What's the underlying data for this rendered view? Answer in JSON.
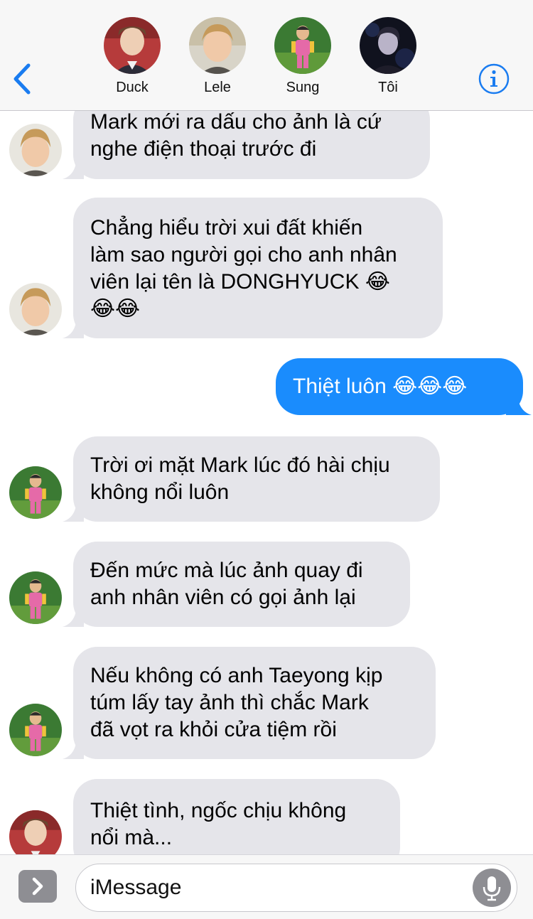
{
  "header": {
    "back_icon": "chevron-left-icon",
    "info_icon": "info-icon",
    "accent_color": "#1a7cf0",
    "participants": [
      {
        "name": "Duck"
      },
      {
        "name": "Lele"
      },
      {
        "name": "Sung"
      },
      {
        "name": "Tôi"
      }
    ]
  },
  "messages": [
    {
      "sender": "Lele",
      "direction": "incoming",
      "lines": [
        "Mark mới ra dấu cho ảnh là cứ",
        "nghe điện thoại trước đi"
      ]
    },
    {
      "sender": "Lele",
      "direction": "incoming",
      "lines": [
        "Chẳng hiểu trời xui đất khiến",
        "làm sao người gọi cho anh nhân",
        "viên lại tên là DONGHYUCK",
        ""
      ],
      "emoji_line3": "😂",
      "emoji_line4": "😂😂"
    },
    {
      "sender": "Tôi",
      "direction": "outgoing",
      "text": "Thiệt luôn",
      "emoji": "😂😂😂"
    },
    {
      "sender": "Sung",
      "direction": "incoming",
      "lines": [
        "Trời ơi mặt Mark lúc đó hài chịu",
        "không nổi luôn"
      ]
    },
    {
      "sender": "Sung",
      "direction": "incoming",
      "lines": [
        "Đến mức mà lúc ảnh quay đi",
        "anh nhân viên có gọi ảnh lại"
      ]
    },
    {
      "sender": "Sung",
      "direction": "incoming",
      "lines": [
        "Nếu không có anh Taeyong kịp",
        "túm lấy tay ảnh thì chắc Mark",
        "đã vọt ra khỏi cửa tiệm rồi"
      ]
    },
    {
      "sender": "Duck",
      "direction": "incoming",
      "lines": [
        "Thiệt tình, ngốc chịu không",
        "nổi mà..."
      ]
    }
  ],
  "colors": {
    "incoming_bubble": "#e5e5ea",
    "outgoing_bubble": "#1a8cfd",
    "header_bg": "#f7f7f7"
  },
  "input": {
    "placeholder": "iMessage",
    "apps_icon": "chevron-right-icon",
    "mic_icon": "microphone-icon"
  }
}
